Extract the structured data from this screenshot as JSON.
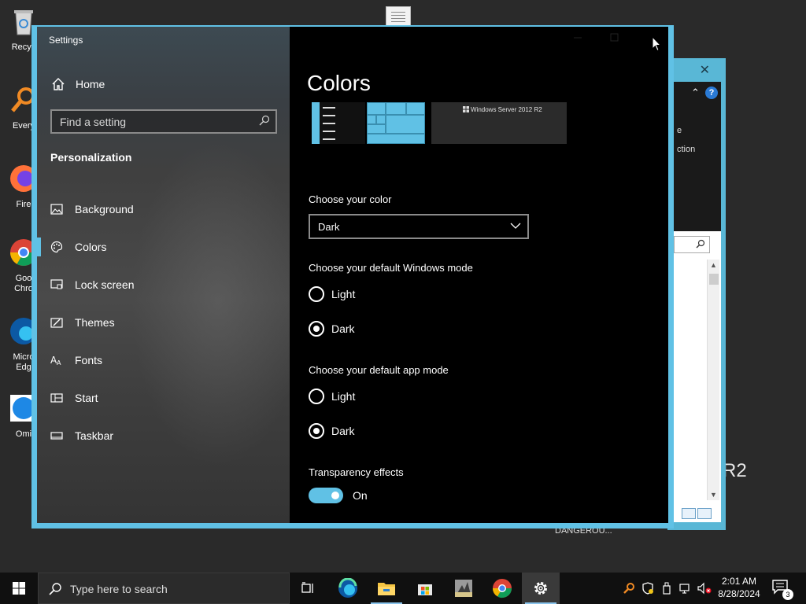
{
  "desktop": {
    "icons": [
      {
        "label": "Recyc",
        "icon": "recycle-bin-icon"
      },
      {
        "label": "Every",
        "icon": "everything-search-icon"
      },
      {
        "label": "Fire",
        "icon": "firefox-icon"
      },
      {
        "label": "Goo\nChro",
        "icon": "chrome-icon"
      },
      {
        "label": "Micro\nEdg",
        "icon": "edge-icon"
      },
      {
        "label": "Omi",
        "icon": "omi-icon"
      }
    ],
    "watermark": "R2",
    "danger_label": "DANGEROU..."
  },
  "bg_window": {
    "close_glyph": "✕",
    "help_glyph": "?",
    "fragment_1": "e",
    "fragment_2": "ction"
  },
  "settings": {
    "title": "Settings",
    "home": "Home",
    "search_placeholder": "Find a setting",
    "category": "Personalization",
    "nav": [
      {
        "label": "Background",
        "icon": "image-icon"
      },
      {
        "label": "Colors",
        "icon": "palette-icon"
      },
      {
        "label": "Lock screen",
        "icon": "lock-screen-icon"
      },
      {
        "label": "Themes",
        "icon": "themes-icon"
      },
      {
        "label": "Fonts",
        "icon": "fonts-icon"
      },
      {
        "label": "Start",
        "icon": "start-icon"
      },
      {
        "label": "Taskbar",
        "icon": "taskbar-icon"
      }
    ],
    "active_nav": "Colors",
    "page_title": "Colors",
    "preview_brand": "Windows Server 2012 R2",
    "choose_color_label": "Choose your color",
    "choose_color_value": "Dark",
    "windows_mode_label": "Choose your default Windows mode",
    "windows_mode_options": [
      "Light",
      "Dark"
    ],
    "windows_mode_selected": "Dark",
    "app_mode_label": "Choose your default app mode",
    "app_mode_options": [
      "Light",
      "Dark"
    ],
    "app_mode_selected": "Dark",
    "transparency_label": "Transparency effects",
    "transparency_state": "On",
    "accent_color": "#60c1e5"
  },
  "taskbar": {
    "search_placeholder": "Type here to search",
    "apps": [
      "task-view-icon",
      "edge-icon",
      "file-explorer-icon",
      "store-icon",
      "app-icon",
      "chrome-icon",
      "settings-gear-icon"
    ],
    "time": "2:01 AM",
    "date": "8/28/2024",
    "notification_count": "3"
  }
}
